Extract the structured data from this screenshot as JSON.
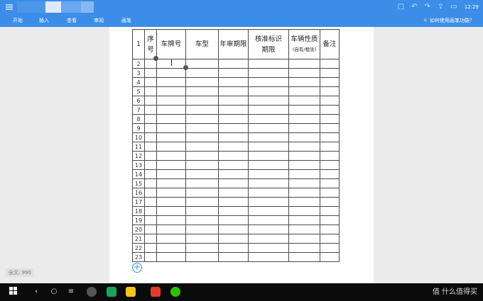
{
  "titlebar": {
    "menu_icon": "menu-icon",
    "time": "12:29",
    "icons": [
      "square-icon",
      "undo-icon",
      "redo-icon",
      "share-icon",
      "minimize-icon"
    ]
  },
  "ribbon": {
    "tabs": [
      "开始",
      "插入",
      "查看",
      "审阅",
      "画笔"
    ],
    "help": "如何使用画笔功能？"
  },
  "table": {
    "headers": {
      "seq_top": "序",
      "seq_bottom": "号",
      "plate": "车牌号",
      "model": "车型",
      "inspection": "年审期限",
      "approval_top": "核准标识",
      "approval_bottom": "期限",
      "nature_top": "车辆性质",
      "nature_bottom": "(自有/租赁)",
      "note": "备注"
    },
    "row_numbers": [
      "1",
      "2",
      "3",
      "4",
      "5",
      "6",
      "7",
      "8",
      "9",
      "10",
      "11",
      "12",
      "13",
      "14",
      "15",
      "16",
      "17",
      "18",
      "19",
      "20",
      "21",
      "22",
      "23"
    ]
  },
  "word_count": "全文: 990",
  "taskbar": {
    "nav": [
      "windows-icon",
      "back-icon",
      "home-icon",
      "recents-icon"
    ],
    "watermark": "值 什么值得买"
  },
  "colors": {
    "accent": "#3b8de8",
    "taskbar": "#0b0b0b",
    "grid": "#4a4a4a"
  }
}
